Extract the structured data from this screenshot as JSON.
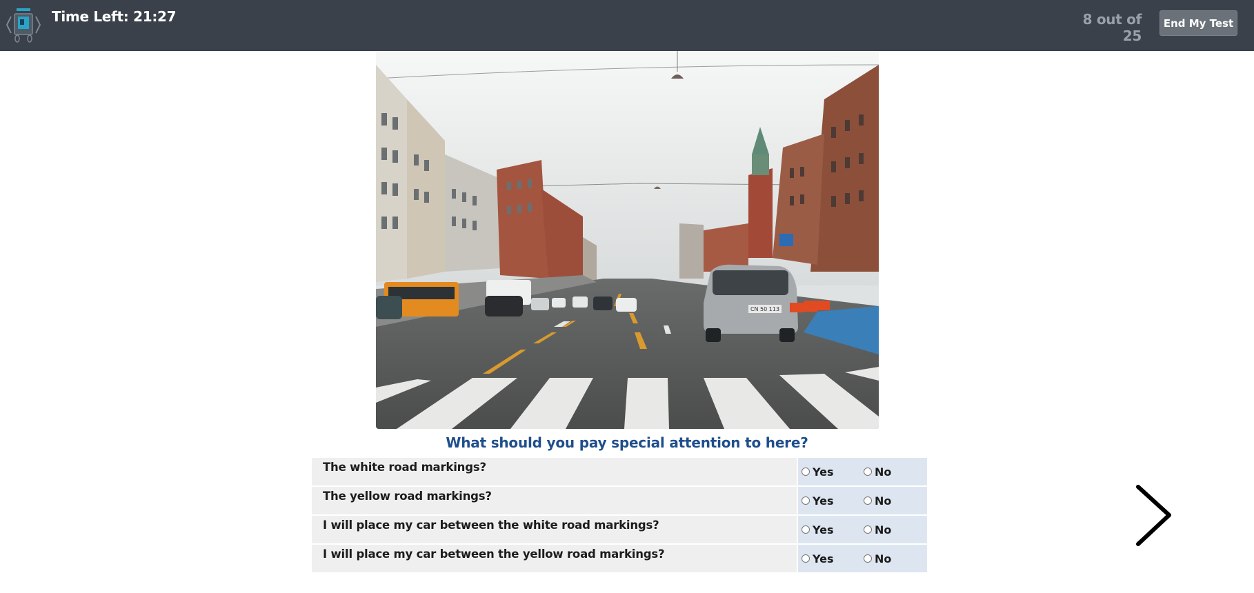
{
  "header": {
    "timer_text": "Time Left: 21:27",
    "progress_text": "8 out of 25",
    "end_button_label": "End My Test"
  },
  "question": {
    "text": "What should you pay special attention to here?",
    "rows": [
      {
        "statement": "The white road markings?",
        "yes_label": "Yes",
        "no_label": "No"
      },
      {
        "statement": "The yellow road markings?",
        "yes_label": "Yes",
        "no_label": "No"
      },
      {
        "statement": "I will place my car between the white road markings?",
        "yes_label": "Yes",
        "no_label": "No"
      },
      {
        "statement": "I will place my car between the yellow road markings?",
        "yes_label": "Yes",
        "no_label": "No"
      }
    ]
  },
  "photo": {
    "license_plate": "CN 50 113"
  },
  "icons": {
    "logo": "test-logo-icon",
    "next": "chevron-right-icon"
  },
  "colors": {
    "topbar": "#3b414b",
    "question_text": "#1f4e8c",
    "statement_bg": "#efefef",
    "choice_bg": "#dde6f0"
  }
}
